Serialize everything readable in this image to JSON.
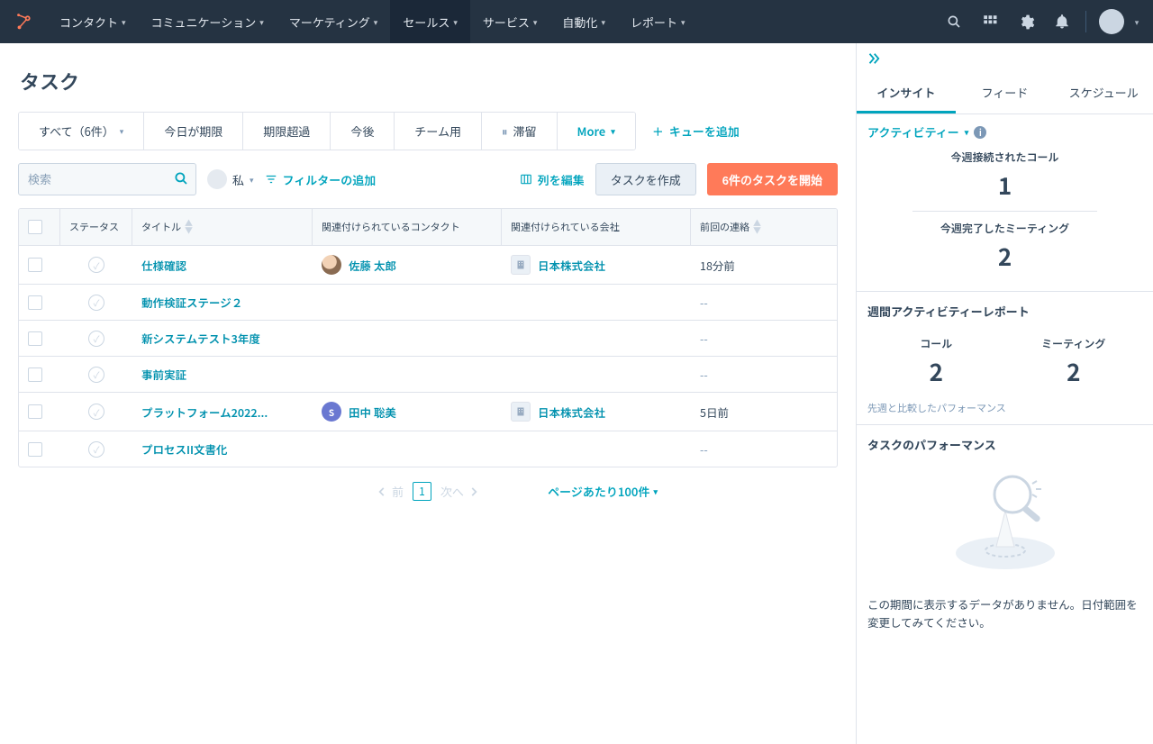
{
  "nav": {
    "items": [
      {
        "label": "コンタクト"
      },
      {
        "label": "コミュニケーション"
      },
      {
        "label": "マーケティング"
      },
      {
        "label": "セールス",
        "active": true
      },
      {
        "label": "サービス"
      },
      {
        "label": "自動化"
      },
      {
        "label": "レポート"
      }
    ]
  },
  "page": {
    "title": "タスク"
  },
  "view_tabs": {
    "items": [
      {
        "label": "すべて（6件）",
        "caret": true
      },
      {
        "label": "今日が期限"
      },
      {
        "label": "期限超過"
      },
      {
        "label": "今後"
      },
      {
        "label": "チーム用"
      },
      {
        "label": "滞留",
        "icon": "pause"
      }
    ],
    "more_label": "More",
    "add_queue_label": "キューを追加"
  },
  "controls": {
    "search_placeholder": "検索",
    "user_label": "私",
    "filter_label": "フィルターの追加",
    "edit_columns_label": "列を編集",
    "create_task_label": "タスクを作成",
    "start_tasks_label": "6件のタスクを開始"
  },
  "table": {
    "headers": {
      "status": "ステータス",
      "title": "タイトル",
      "contact": "関連付けられているコンタクト",
      "company": "関連付けられている会社",
      "last_contact": "前回の連絡"
    },
    "rows": [
      {
        "title": "仕様確認",
        "contact": "佐藤 太郎",
        "contact_avatar": "photo",
        "company": "日本株式会社",
        "last": "18分前"
      },
      {
        "title": "動作検証ステージ２",
        "contact": "",
        "company": "",
        "last": "--"
      },
      {
        "title": "新システムテスト3年度",
        "contact": "",
        "company": "",
        "last": "--"
      },
      {
        "title": "事前実証",
        "contact": "",
        "company": "",
        "last": "--"
      },
      {
        "title": "プラットフォーム2022...",
        "contact": "田中 聡美",
        "contact_avatar": "S",
        "contact_color": "#6a78d1",
        "company": "日本株式会社",
        "last": "5日前"
      },
      {
        "title": "プロセスII文書化",
        "contact": "",
        "company": "",
        "last": "--"
      }
    ]
  },
  "pagination": {
    "prev": "前",
    "page": "1",
    "next": "次へ",
    "per_page_label": "ページあたり100件"
  },
  "side": {
    "tabs": {
      "insight": "インサイト",
      "feed": "フィード",
      "schedule": "スケジュール"
    },
    "activity_label": "アクティビティー",
    "stat1": {
      "label": "今週接続されたコール",
      "value": "1"
    },
    "stat2": {
      "label": "今週完了したミーティング",
      "value": "2"
    },
    "weekly_title": "週間アクティビティーレポート",
    "calls": {
      "label": "コール",
      "value": "2"
    },
    "meetings": {
      "label": "ミーティング",
      "value": "2"
    },
    "compare_note": "先週と比較したパフォーマンス",
    "perf_title": "タスクのパフォーマンス",
    "empty_text": "この期間に表示するデータがありません。日付範囲を変更してみてください。"
  }
}
